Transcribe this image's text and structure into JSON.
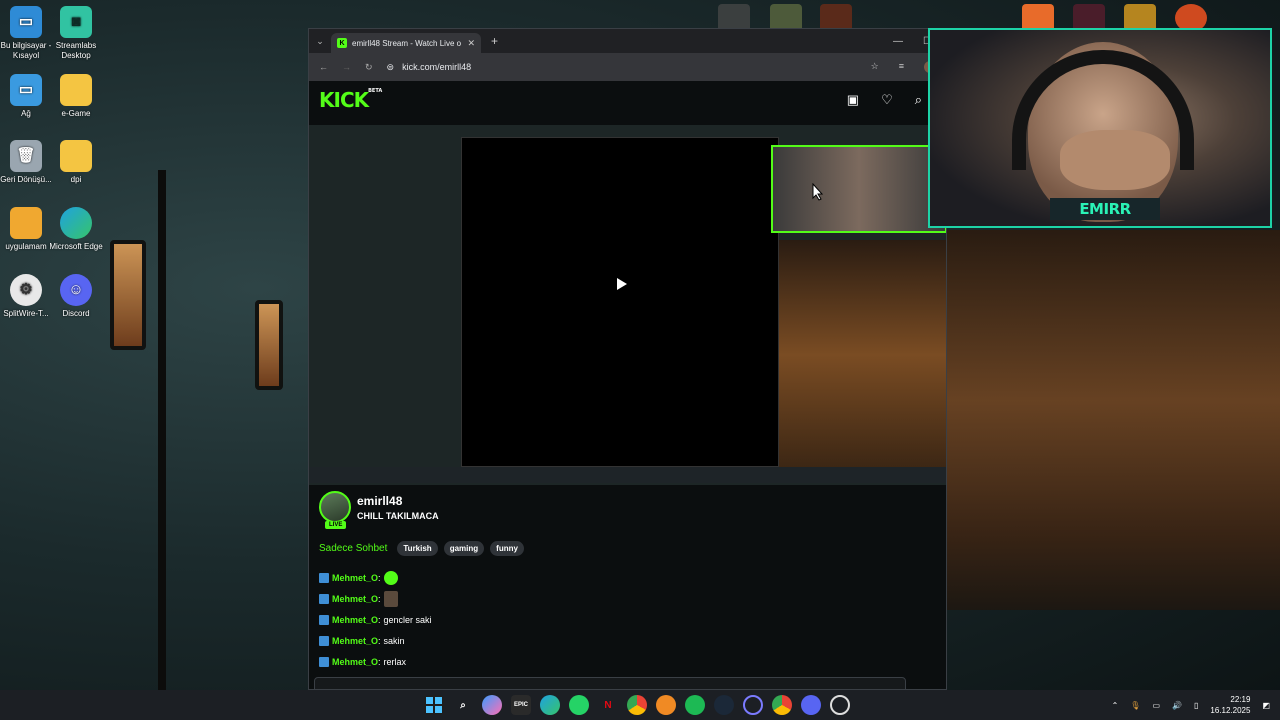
{
  "desktop": {
    "icons": [
      {
        "label": "Bu bilgisayar - Kısayol",
        "icon": "computer-icon"
      },
      {
        "label": "Streamlabs Desktop",
        "icon": "streamlabs-icon"
      },
      {
        "label": "Ağ",
        "icon": "network-icon"
      },
      {
        "label": "e-Game",
        "icon": "folder-icon"
      },
      {
        "label": "Geri Dönüşü...",
        "icon": "recycle-bin-icon"
      },
      {
        "label": "dpi",
        "icon": "folder-icon"
      },
      {
        "label": "uygulamam",
        "icon": "folder-icon"
      },
      {
        "label": "Microsoft Edge",
        "icon": "edge-icon"
      },
      {
        "label": "SplitWire-T...",
        "icon": "splitwire-icon"
      },
      {
        "label": "Discord",
        "icon": "discord-icon"
      }
    ]
  },
  "browser": {
    "tab_title": "emirll48 Stream - Watch Live o",
    "url": "kick.com/emirll48",
    "kick_logo": "KICK",
    "kick_beta": "BETA"
  },
  "stream": {
    "streamer": "emirll48",
    "title": "CHILL TAKILMACA",
    "live_badge": "LIVE",
    "category": "Sadece Sohbet",
    "tags": [
      "Turkish",
      "gaming",
      "funny"
    ]
  },
  "chat": [
    {
      "user": "Mehmet_O",
      "msg": "",
      "emote": "green-emote"
    },
    {
      "user": "Mehmet_O",
      "msg": "",
      "emote": "face-emote"
    },
    {
      "user": "Mehmet_O",
      "msg": "gencler saki"
    },
    {
      "user": "Mehmet_O",
      "msg": "sakin"
    },
    {
      "user": "Mehmet_O",
      "msg": "rerlax"
    }
  ],
  "webcam": {
    "overlay_name": "EMIRR"
  },
  "taskbar": {
    "time": "22:19",
    "date": "16.12.2025"
  },
  "colors": {
    "kick_green": "#53fc18",
    "cam_border": "#1dd3a7"
  }
}
